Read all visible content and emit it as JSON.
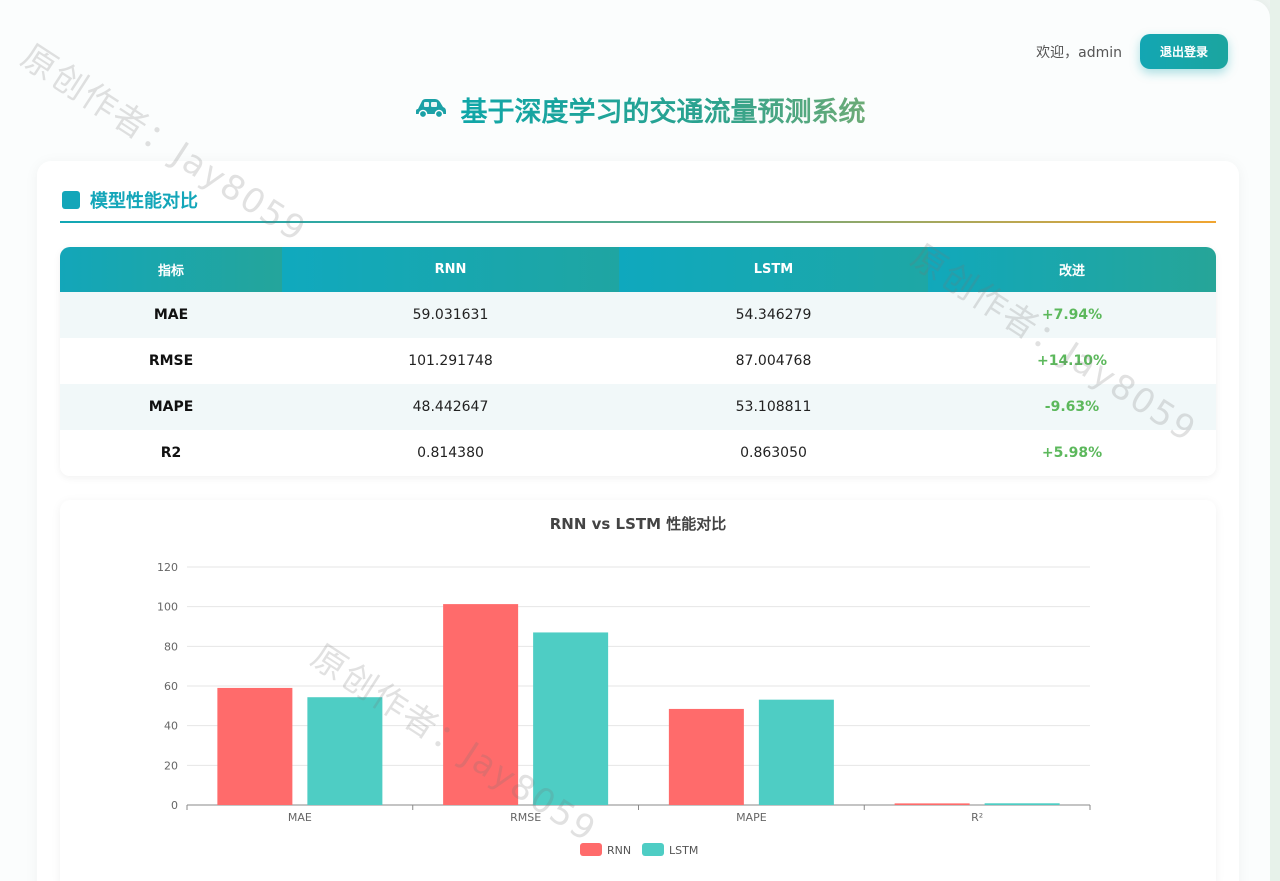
{
  "header": {
    "welcome": "欢迎，admin",
    "logout_label": "退出登录",
    "title": "基于深度学习的交通流量预测系统",
    "title_icon": "car-icon"
  },
  "section": {
    "title": "模型性能对比"
  },
  "table": {
    "headers": [
      "指标",
      "RNN",
      "LSTM",
      "改进"
    ],
    "rows": [
      {
        "metric": "MAE",
        "rnn": "59.031631",
        "lstm": "54.346279",
        "improve": "+7.94%"
      },
      {
        "metric": "RMSE",
        "rnn": "101.291748",
        "lstm": "87.004768",
        "improve": "+14.10%"
      },
      {
        "metric": "MAPE",
        "rnn": "48.442647",
        "lstm": "53.108811",
        "improve": "-9.63%"
      },
      {
        "metric": "R2",
        "rnn": "0.814380",
        "lstm": "0.863050",
        "improve": "+5.98%"
      }
    ]
  },
  "watermark": "原创作者：Jay8059",
  "colors": {
    "accent": "#13a6b9",
    "rnn": "#ff6b6b",
    "lstm": "#4ecdc4",
    "positive": "#5cb85c"
  },
  "chart_data": {
    "type": "bar",
    "title": "RNN vs LSTM 性能对比",
    "categories": [
      "MAE",
      "RMSE",
      "MAPE",
      "R²"
    ],
    "series": [
      {
        "name": "RNN",
        "values": [
          59.031631,
          101.291748,
          48.442647,
          0.81438
        ]
      },
      {
        "name": "LSTM",
        "values": [
          54.346279,
          87.004768,
          53.108811,
          0.86305
        ]
      }
    ],
    "ylim": [
      0,
      120
    ],
    "yticks": [
      0,
      20,
      40,
      60,
      80,
      100,
      120
    ],
    "grid": true,
    "legend": "bottom-center"
  }
}
